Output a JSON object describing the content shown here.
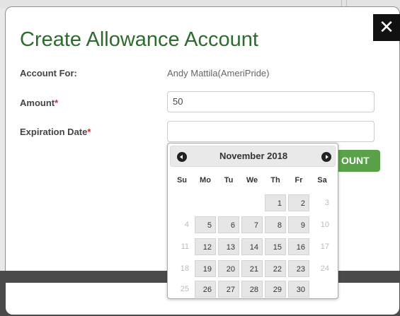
{
  "dialog": {
    "title": "Create Allowance Account",
    "close_symbol": "✕",
    "submit_button_visible_text": "OUNT"
  },
  "fields": {
    "account_for": {
      "label": "Account For:",
      "value": "Andy Mattila(AmeriPride)"
    },
    "amount": {
      "label": "Amount",
      "required_mark": "*",
      "value": "50"
    },
    "expiration_date": {
      "label": "Expiration Date",
      "required_mark": "*",
      "value": ""
    }
  },
  "calendar": {
    "month_label": "November 2018",
    "weekdays": [
      "Su",
      "Mo",
      "Tu",
      "We",
      "Th",
      "Fr",
      "Sa"
    ],
    "weeks": [
      [
        null,
        null,
        null,
        null,
        "1",
        "2",
        "3"
      ],
      [
        "4",
        "5",
        "6",
        "7",
        "8",
        "9",
        "10"
      ],
      [
        "11",
        "12",
        "13",
        "14",
        "15",
        "16",
        "17"
      ],
      [
        "18",
        "19",
        "20",
        "21",
        "22",
        "23",
        "24"
      ],
      [
        "25",
        "26",
        "27",
        "28",
        "29",
        "30",
        null
      ]
    ],
    "disabled_days": [
      "3",
      "4",
      "10",
      "11",
      "17",
      "18",
      "24",
      "25"
    ],
    "prev_icon": "chevron-left-icon",
    "next_icon": "chevron-right-icon"
  },
  "colors": {
    "title_green": "#2e6b2e",
    "button_green": "#5aa24a",
    "required_red": "#c9302c"
  }
}
